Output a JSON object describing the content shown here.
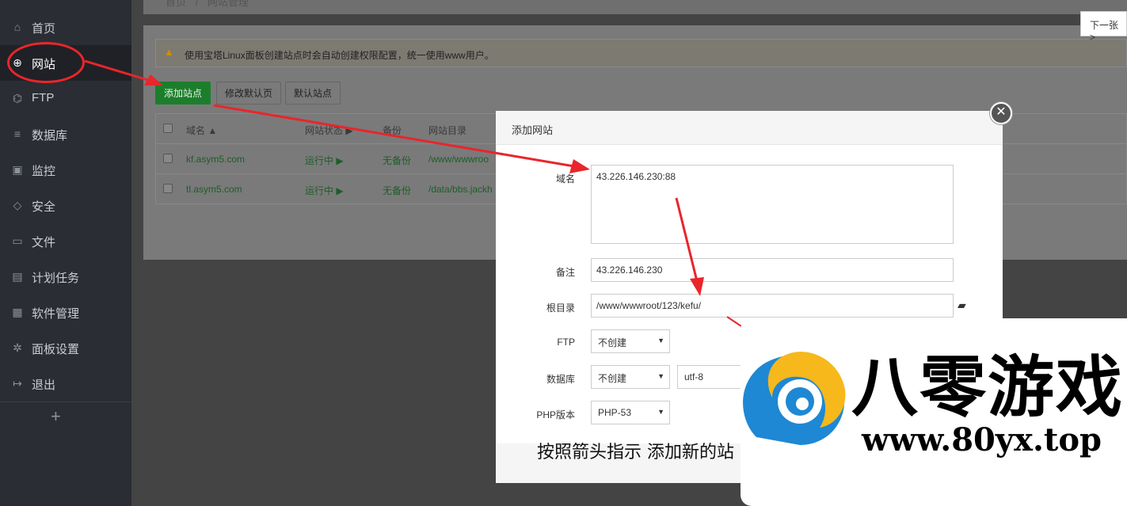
{
  "sidebar": {
    "items": [
      {
        "label": "首页",
        "icon": "home-icon",
        "glyph": "⌂"
      },
      {
        "label": "网站",
        "icon": "globe-icon",
        "glyph": "⊕"
      },
      {
        "label": "FTP",
        "icon": "ftp-icon",
        "glyph": "⌬"
      },
      {
        "label": "数据库",
        "icon": "database-icon",
        "glyph": "≡"
      },
      {
        "label": "监控",
        "icon": "monitor-icon",
        "glyph": "▣"
      },
      {
        "label": "安全",
        "icon": "shield-icon",
        "glyph": "◇"
      },
      {
        "label": "文件",
        "icon": "folder-icon",
        "glyph": "▭"
      },
      {
        "label": "计划任务",
        "icon": "calendar-icon",
        "glyph": "▤"
      },
      {
        "label": "软件管理",
        "icon": "grid-icon",
        "glyph": "▦"
      },
      {
        "label": "面板设置",
        "icon": "gear-icon",
        "glyph": "✲"
      },
      {
        "label": "退出",
        "icon": "logout-icon",
        "glyph": "↦"
      }
    ],
    "add_glyph": "+"
  },
  "breadcrumb": {
    "home": "首页",
    "sep": "/",
    "current": "网站管理"
  },
  "notice": {
    "icon": "▲",
    "text": "使用宝塔Linux面板创建站点时会自动创建权限配置，统一使用www用户。"
  },
  "toolbar": {
    "add_site": "添加站点",
    "edit_default_page": "修改默认页",
    "default_site": "默认站点"
  },
  "table": {
    "headers": [
      "域名 ▲",
      "网站状态 ▶",
      "备份",
      "网站目录"
    ],
    "rows": [
      {
        "domain": "kf.asym5.com",
        "status": "运行中 ▶",
        "backup": "无备份",
        "dir": "/www/wwwroo"
      },
      {
        "domain": "tl.asym5.com",
        "status": "运行中 ▶",
        "backup": "无备份",
        "dir": "/data/bbs.jackh"
      }
    ]
  },
  "next_page": "下一张 >",
  "modal": {
    "title": "添加网站",
    "close": "✕",
    "domain_label": "域名",
    "domain_value": "43.226.146.230:88",
    "remark_label": "备注",
    "remark_value": "43.226.146.230",
    "root_label": "根目录",
    "root_value": "/www/wwwroot/123/kefu/",
    "folder_glyph": "▰",
    "ftp_label": "FTP",
    "ftp_value": "不创建",
    "db_label": "数据库",
    "db_value": "不创建",
    "db_charset": "utf-8",
    "php_label": "PHP版本",
    "php_value": "PHP-53",
    "caret": "▼"
  },
  "caption": "按照箭头指示  添加新的站",
  "watermark": {
    "name": "八零游戏",
    "url": "www.80yx.top"
  },
  "colors": {
    "arrow": "#e8262b",
    "sidebar": "#2a2d33",
    "primary": "#1c7e2c"
  }
}
